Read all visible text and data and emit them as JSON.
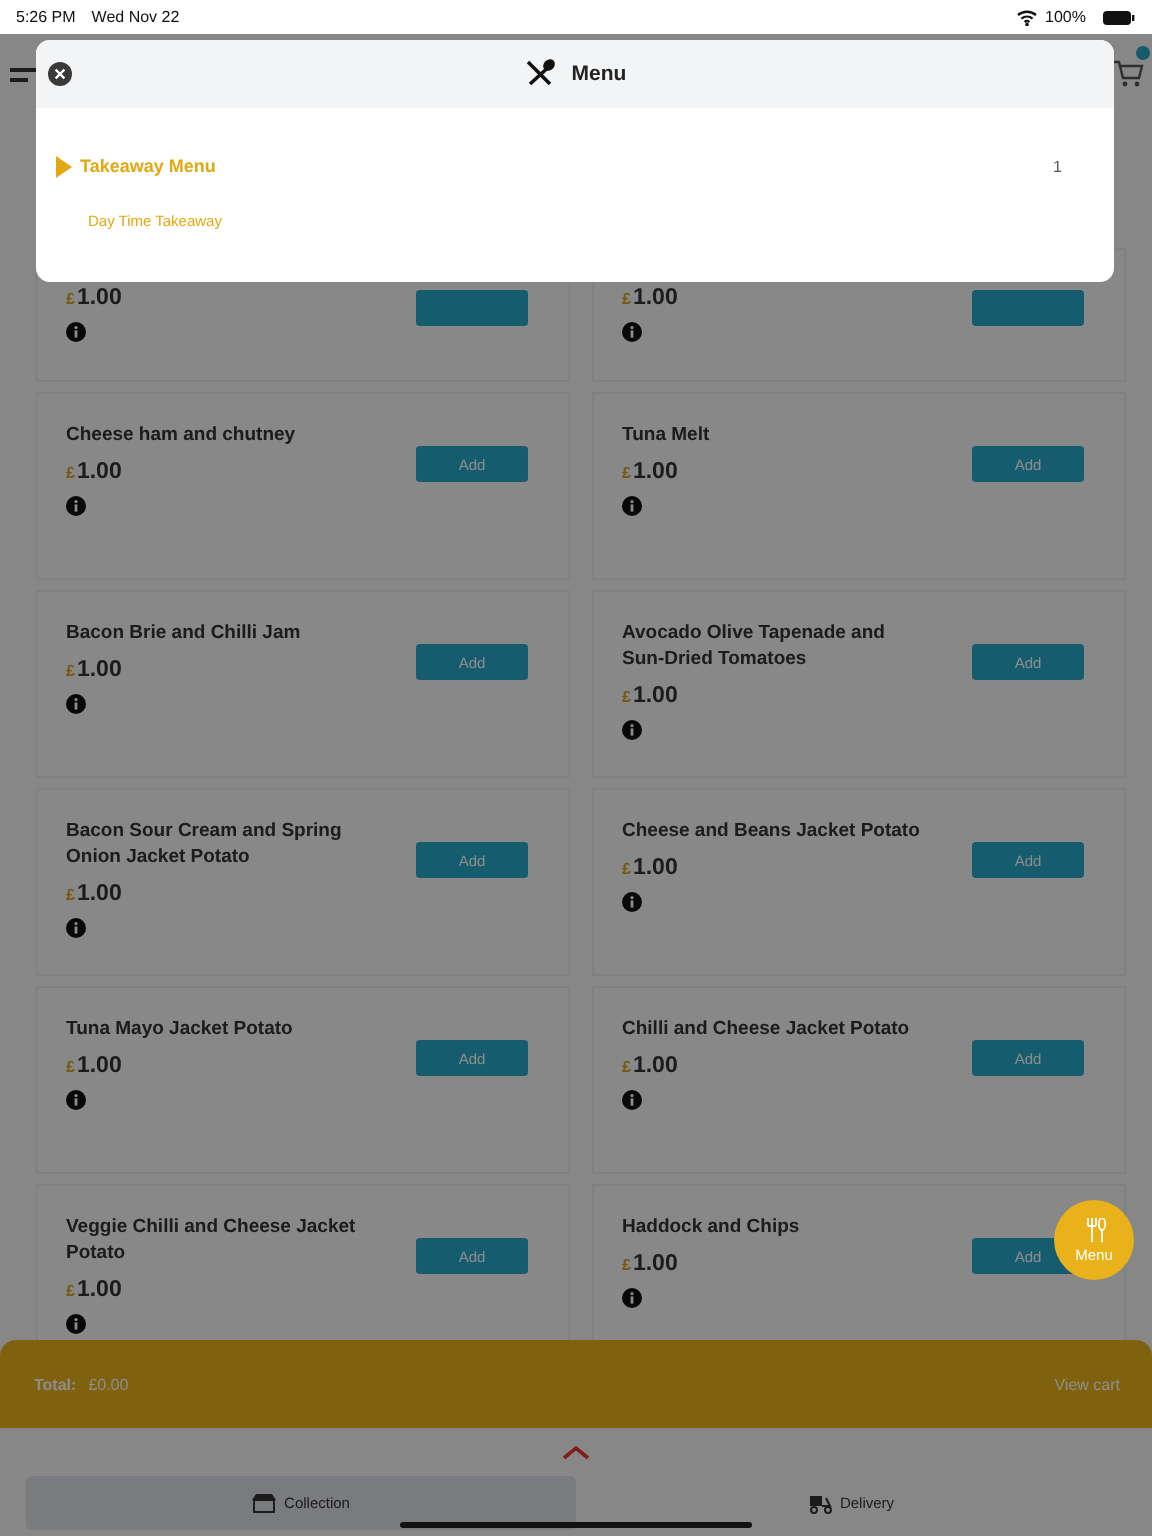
{
  "status_bar": {
    "time": "5:26 PM",
    "date": "Wed Nov 22",
    "battery": "100%"
  },
  "modal": {
    "title": "Menu",
    "groups": [
      {
        "label": "Takeaway Menu",
        "count": "1",
        "children": [
          {
            "label": "Day Time Takeaway"
          }
        ]
      }
    ]
  },
  "products": [
    {
      "currency": "£",
      "price": "1.00"
    },
    {
      "currency": "£",
      "price": "1.00"
    },
    {
      "name": "Cheese ham and chutney",
      "currency": "£",
      "price": "1.00",
      "button": "Add"
    },
    {
      "name": "Tuna Melt",
      "currency": "£",
      "price": "1.00",
      "button": "Add"
    },
    {
      "name": "Bacon Brie and Chilli Jam",
      "currency": "£",
      "price": "1.00",
      "button": "Add"
    },
    {
      "name": "Avocado Olive Tapenade and Sun-Dried Tomatoes",
      "currency": "£",
      "price": "1.00",
      "button": "Add"
    },
    {
      "name": "Bacon Sour Cream and Spring Onion Jacket Potato",
      "currency": "£",
      "price": "1.00",
      "button": "Add"
    },
    {
      "name": "Cheese and Beans Jacket Potato",
      "currency": "£",
      "price": "1.00",
      "button": "Add"
    },
    {
      "name": "Tuna Mayo Jacket Potato",
      "currency": "£",
      "price": "1.00",
      "button": "Add"
    },
    {
      "name": "Chilli and Cheese Jacket Potato",
      "currency": "£",
      "price": "1.00",
      "button": "Add"
    },
    {
      "name": "Veggie Chilli and Cheese Jacket Potato",
      "currency": "£",
      "price": "1.00",
      "button": "Add"
    },
    {
      "name": "Haddock and Chips",
      "currency": "£",
      "price": "1.00",
      "button": "Add"
    }
  ],
  "floating_button": {
    "label": "Menu"
  },
  "total_bar": {
    "label": "Total:",
    "amount": "£0.00",
    "action": "View cart"
  },
  "tabs": [
    {
      "label": "Collection",
      "selected": true
    },
    {
      "label": "Delivery",
      "selected": false
    }
  ]
}
